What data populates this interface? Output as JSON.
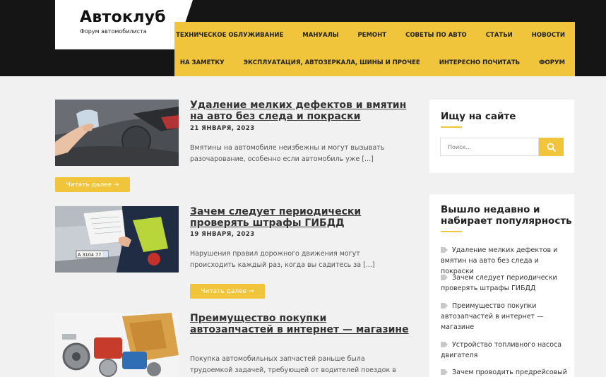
{
  "site": {
    "title": "Автоклуб",
    "subtitle": "Форум автомобилиста"
  },
  "nav": {
    "row1": [
      "Техническое облуживание",
      "Мануалы",
      "Ремонт",
      "Советы по авто",
      "Статьи",
      "Новости"
    ],
    "row2": [
      "На заметку",
      "Эксплуатация, автозеркала, шины и прочее",
      "Интересно почитать",
      "Форум"
    ]
  },
  "posts": [
    {
      "title": "Удаление мелких дефектов и вмятин на авто без следа и покраски",
      "date": "21 ЯНВАРЯ, 2023",
      "excerpt": "Вмятины на автомобиле неизбежны и могут вызывать разочарование, особенно если автомобиль уже [...]",
      "read_more": "Читать далее →"
    },
    {
      "title": "Зачем следует периодически проверять штрафы ГИБДД",
      "date": "19 ЯНВАРЯ, 2023",
      "excerpt": "Нарушения правил дорожного движения могут происходить каждый раз, когда вы садитесь за [...]",
      "read_more": "Читать далее →",
      "plate": "А 3104 77"
    },
    {
      "title": "Преимущество покупки автозапчастей в интернет — магазине",
      "excerpt": "Покупка автомобильных запчастей раньше была трудоемкой задачей, требующей от водителей поездок в [...]"
    }
  ],
  "sidebar": {
    "search": {
      "title": "Ищу на сайте",
      "placeholder": "Поиск..."
    },
    "popular": {
      "title": "Вышло недавно и набирает популярность",
      "items": [
        "Удаление мелких дефектов и вмятин на авто без следа и покраски",
        "Зачем следует периодически проверять штрафы ГИБДД",
        "Преимущество покупки автозапчастей в интернет — магазине",
        "Устройство топливного насоса двигателя",
        "Зачем проводить предрейсовый"
      ]
    }
  },
  "colors": {
    "accent": "#f0c53b",
    "header_bg": "#151515",
    "page_bg": "#f1f1f1"
  }
}
